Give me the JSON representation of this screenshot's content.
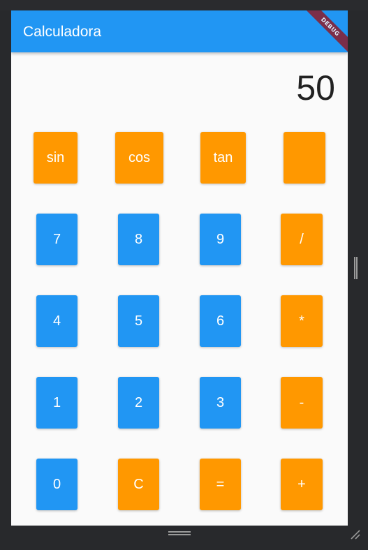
{
  "app_bar": {
    "title": "Calculadora",
    "debug_label": "DEBUG"
  },
  "display": {
    "value": "50"
  },
  "keys": {
    "sin": "sin",
    "cos": "cos",
    "tan": "tan",
    "blank": "",
    "k7": "7",
    "k8": "8",
    "k9": "9",
    "divide": "/",
    "k4": "4",
    "k5": "5",
    "k6": "6",
    "multiply": "*",
    "k1": "1",
    "k2": "2",
    "k3": "3",
    "minus": "-",
    "k0": "0",
    "clear": "C",
    "equals": "=",
    "plus": "+"
  },
  "colors": {
    "primary": "#2196f3",
    "accent": "#ff9800",
    "debug_banner": "#8b1c2c"
  }
}
